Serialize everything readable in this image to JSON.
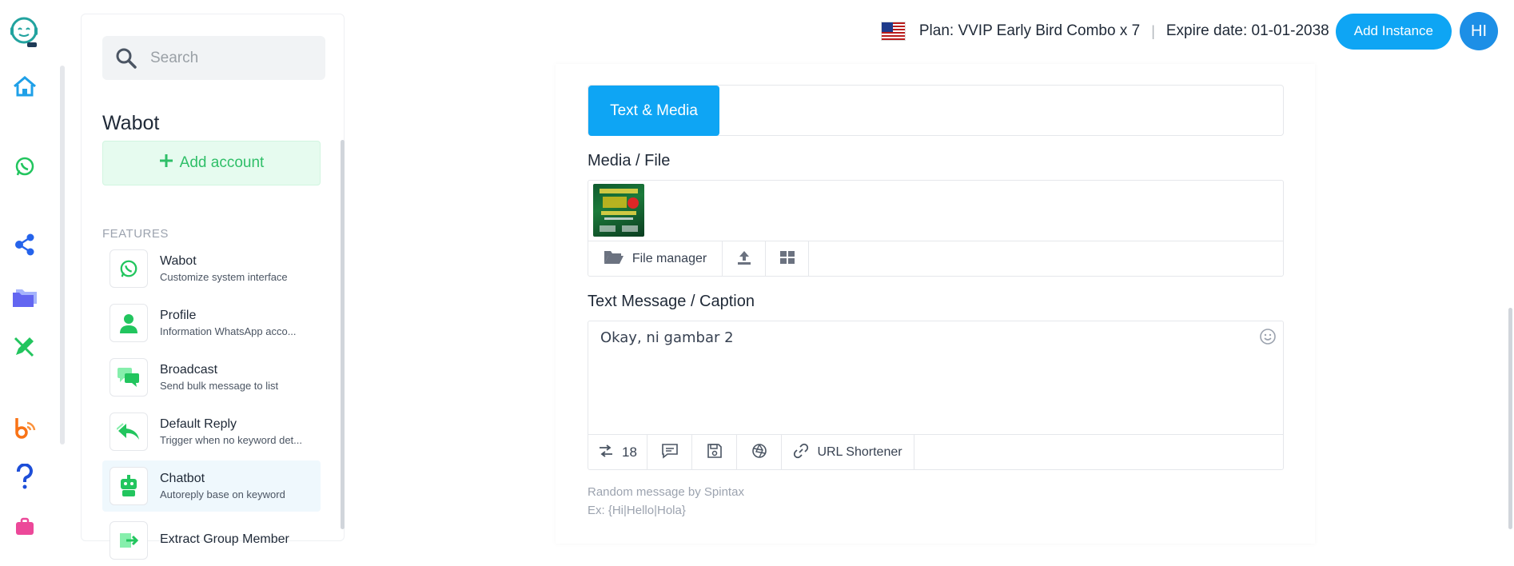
{
  "rail": {
    "items": [
      {
        "icon": "robot-logo-icon",
        "color": "#22a39f"
      },
      {
        "icon": "home-icon",
        "color": "#1fa0e8"
      },
      {
        "icon": "whatsapp-icon",
        "color": "#22c55e"
      },
      {
        "icon": "share-icon",
        "color": "#2563eb"
      },
      {
        "icon": "folder-icon",
        "color": "#6366f1"
      },
      {
        "icon": "pencil-icon",
        "color": "#22c55e"
      },
      {
        "icon": "blogger-icon",
        "color": "#f97316"
      },
      {
        "icon": "help-icon",
        "color": "#1d4ed8"
      },
      {
        "icon": "tools-icon",
        "color": "#ec4899"
      }
    ]
  },
  "sidebar": {
    "search_placeholder": "Search",
    "title": "Wabot",
    "add_account_label": "Add account",
    "features_label": "FEATURES",
    "items": [
      {
        "title": "Wabot",
        "desc": "Customize system interface",
        "icon": "whatsapp-icon"
      },
      {
        "title": "Profile",
        "desc": "Information WhatsApp acco...",
        "icon": "user-icon"
      },
      {
        "title": "Broadcast",
        "desc": "Send bulk message to list",
        "icon": "chat-bubbles-icon"
      },
      {
        "title": "Default Reply",
        "desc": "Trigger when no keyword det...",
        "icon": "reply-icon"
      },
      {
        "title": "Chatbot",
        "desc": "Autoreply base on keyword",
        "icon": "bot-icon",
        "active": true
      },
      {
        "title": "Extract Group Member",
        "desc": "",
        "icon": "export-icon"
      }
    ]
  },
  "header": {
    "plan": "Plan: VVIP Early Bird Combo x 7",
    "separator": "|",
    "expire": "Expire date: 01-01-2038",
    "add_instance_label": "Add Instance",
    "avatar_initials": "HI",
    "accent": "#0ea5f4"
  },
  "main": {
    "tab_active": "Text & Media",
    "media_label": "Media / File",
    "file_manager_label": "File manager",
    "text_label": "Text Message / Caption",
    "message_value": "Okay, ni gambar 2",
    "spintax_count": "18",
    "url_shortener_label": "URL Shortener",
    "hint_line1": "Random message by Spintax",
    "hint_line2": "Ex: {Hi|Hello|Hola}"
  }
}
